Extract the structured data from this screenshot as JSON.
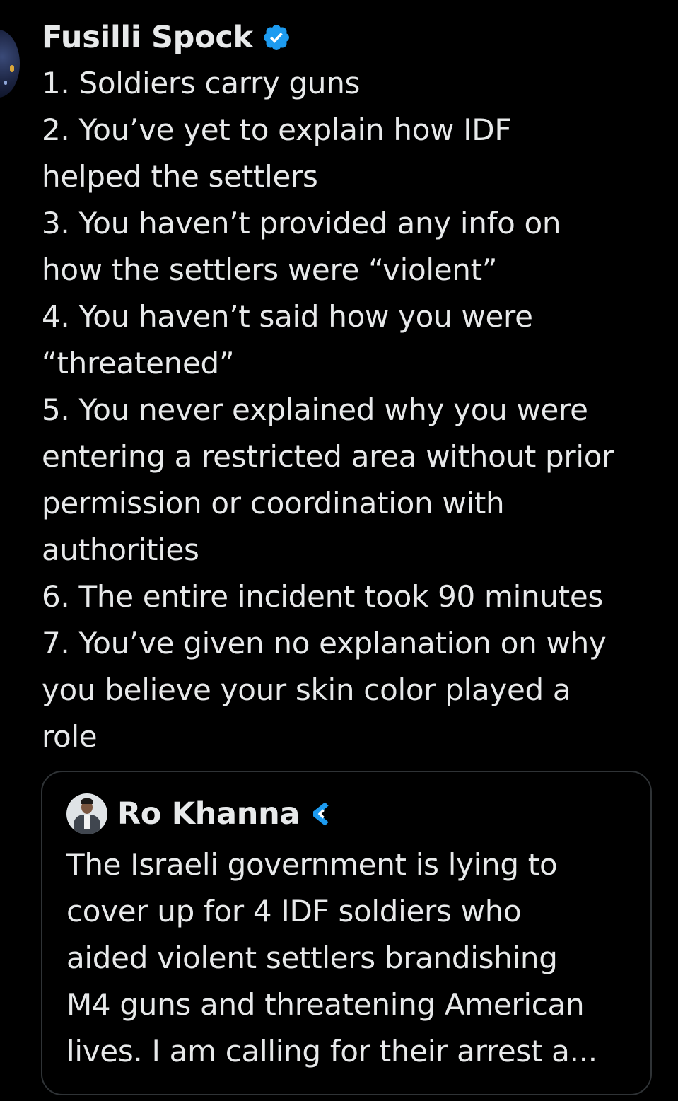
{
  "tweet": {
    "author": {
      "display_name": "Fusilli Spock",
      "verified_icon": "verified-badge-icon",
      "verified_color": "#1d9bf0"
    },
    "lines": [
      "1. Soldiers carry guns",
      "2. You’ve yet to explain how IDF",
      "helped the settlers",
      "3. You haven’t provided any info on",
      "how the settlers were “violent”",
      "4. You haven’t said how you were",
      "“threatened”",
      "5. You never explained why you were",
      "entering a restricted area without prior",
      "permission or coordination with",
      "authorities",
      "6. The entire incident took 90 minutes",
      "7. You’ve given no explanation on why",
      "you believe your skin color played a",
      "role"
    ]
  },
  "quoted_tweet": {
    "author": {
      "display_name": "Ro Khanna",
      "badge_icon": "government-badge-icon",
      "badge_color": "#1d9bf0"
    },
    "lines": [
      "The Israeli government is lying to",
      "cover up for 4 IDF soldiers who",
      "aided violent settlers brandishing",
      "M4 guns and threatening American",
      "lives. I am calling for their arrest a..."
    ]
  },
  "colors": {
    "background": "#000000",
    "text": "#e7e9ea",
    "border": "#2f3336"
  }
}
